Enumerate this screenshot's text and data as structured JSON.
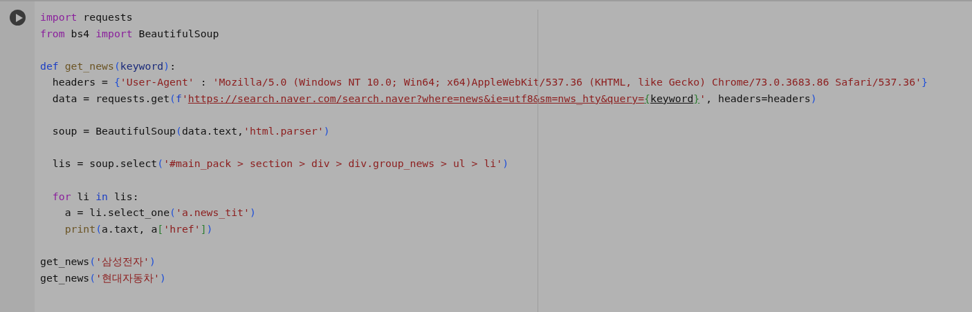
{
  "cell": {
    "lines": [
      {
        "kind": "code",
        "tokens": [
          {
            "kind": "keyword",
            "text": "import"
          },
          {
            "kind": "plain",
            "text": " requests"
          }
        ]
      },
      {
        "kind": "code",
        "tokens": [
          {
            "kind": "keyword",
            "text": "from"
          },
          {
            "kind": "plain",
            "text": " bs4 "
          },
          {
            "kind": "keyword",
            "text": "import"
          },
          {
            "kind": "plain",
            "text": " BeautifulSoup"
          }
        ]
      },
      {
        "kind": "blank"
      },
      {
        "kind": "code",
        "tokens": [
          {
            "kind": "builtin",
            "text": "def "
          },
          {
            "kind": "func",
            "text": "get_news"
          },
          {
            "kind": "paren",
            "text": "("
          },
          {
            "kind": "param",
            "text": "keyword"
          },
          {
            "kind": "paren",
            "text": ")"
          },
          {
            "kind": "plain",
            "text": ":"
          }
        ]
      },
      {
        "kind": "code",
        "tokens": [
          {
            "kind": "plain",
            "text": "  headers = "
          },
          {
            "kind": "paren",
            "text": "{"
          },
          {
            "kind": "string",
            "text": "'User-Agent'"
          },
          {
            "kind": "plain",
            "text": " : "
          },
          {
            "kind": "string",
            "text": "'Mozilla/5.0 (Windows NT 10.0; Win64; x64)AppleWebKit/537.36 (KHTML, like Gecko) Chrome/73.0.3683.86 Safari/537.36'"
          },
          {
            "kind": "paren",
            "text": "}"
          }
        ]
      },
      {
        "kind": "code",
        "tokens": [
          {
            "kind": "plain",
            "text": "  data = requests.get"
          },
          {
            "kind": "paren",
            "text": "("
          },
          {
            "kind": "builtin",
            "text": "f"
          },
          {
            "kind": "string",
            "text": "'"
          },
          {
            "kind": "url",
            "text": "https://search.naver.com/search.naver?where=news&ie=utf8&sm=nws_hty&query="
          },
          {
            "kind": "url-brace",
            "text": "{"
          },
          {
            "kind": "url-var",
            "text": "keyword"
          },
          {
            "kind": "url-brace",
            "text": "}"
          },
          {
            "kind": "string",
            "text": "'"
          },
          {
            "kind": "plain",
            "text": ", headers=headers"
          },
          {
            "kind": "paren",
            "text": ")"
          }
        ]
      },
      {
        "kind": "blank"
      },
      {
        "kind": "code",
        "tokens": [
          {
            "kind": "plain",
            "text": "  soup = BeautifulSoup"
          },
          {
            "kind": "paren",
            "text": "("
          },
          {
            "kind": "plain",
            "text": "data.text,"
          },
          {
            "kind": "string",
            "text": "'html.parser'"
          },
          {
            "kind": "paren",
            "text": ")"
          }
        ]
      },
      {
        "kind": "blank"
      },
      {
        "kind": "code",
        "tokens": [
          {
            "kind": "plain",
            "text": "  lis = soup.select"
          },
          {
            "kind": "paren",
            "text": "("
          },
          {
            "kind": "string",
            "text": "'#main_pack > section > div > div.group_news > ul > li'"
          },
          {
            "kind": "paren",
            "text": ")"
          }
        ]
      },
      {
        "kind": "blank"
      },
      {
        "kind": "code",
        "tokens": [
          {
            "kind": "keyword",
            "text": "  for"
          },
          {
            "kind": "plain",
            "text": " li "
          },
          {
            "kind": "builtin",
            "text": "in"
          },
          {
            "kind": "plain",
            "text": " lis:"
          }
        ]
      },
      {
        "kind": "code",
        "tokens": [
          {
            "kind": "plain",
            "text": "    a = li.select_one"
          },
          {
            "kind": "paren",
            "text": "("
          },
          {
            "kind": "string",
            "text": "'a.news_tit'"
          },
          {
            "kind": "paren",
            "text": ")"
          }
        ]
      },
      {
        "kind": "code",
        "tokens": [
          {
            "kind": "func",
            "text": "    print"
          },
          {
            "kind": "paren",
            "text": "("
          },
          {
            "kind": "plain",
            "text": "a.taxt, a"
          },
          {
            "kind": "bracket",
            "text": "["
          },
          {
            "kind": "string",
            "text": "'href'"
          },
          {
            "kind": "bracket",
            "text": "]"
          },
          {
            "kind": "paren",
            "text": ")"
          }
        ]
      },
      {
        "kind": "blank"
      },
      {
        "kind": "code",
        "tokens": [
          {
            "kind": "plain",
            "text": "get_news"
          },
          {
            "kind": "paren",
            "text": "("
          },
          {
            "kind": "string",
            "text": "'삼성전자'"
          },
          {
            "kind": "paren",
            "text": ")"
          }
        ]
      },
      {
        "kind": "code",
        "tokens": [
          {
            "kind": "plain",
            "text": "get_news"
          },
          {
            "kind": "paren",
            "text": "("
          },
          {
            "kind": "string",
            "text": "'현대자동차'"
          },
          {
            "kind": "paren",
            "text": ")"
          }
        ]
      }
    ]
  }
}
